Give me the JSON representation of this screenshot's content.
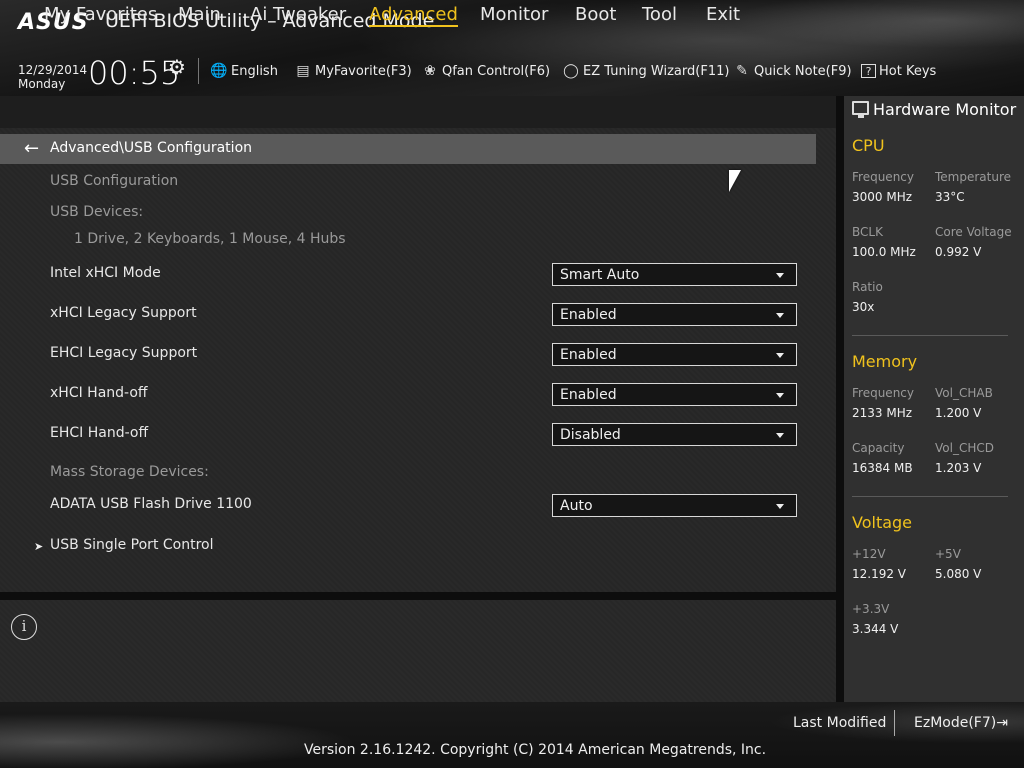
{
  "app": {
    "brand": "ASUS",
    "title": "UEFI BIOS Utility – Advanced Mode"
  },
  "status": {
    "date": "12/29/2014",
    "day": "Monday",
    "time": "00:55"
  },
  "toolbar": {
    "language": "English",
    "favorite": "MyFavorite(F3)",
    "qfan": "Qfan Control(F6)",
    "ez_tuning": "EZ Tuning Wizard(F11)",
    "quick_note": "Quick Note(F9)",
    "hot_keys": "Hot Keys"
  },
  "menu": {
    "items": [
      "My Favorites",
      "Main",
      "Ai Tweaker",
      "Advanced",
      "Monitor",
      "Boot",
      "Tool",
      "Exit"
    ],
    "active": "Advanced"
  },
  "breadcrumb": "Advanced\\USB Configuration",
  "content": {
    "section_title": "USB Configuration",
    "usb_devices_label": "USB Devices:",
    "usb_devices_value": "1 Drive, 2 Keyboards, 1 Mouse, 4 Hubs",
    "settings": [
      {
        "label": "Intel xHCI Mode",
        "value": "Smart Auto"
      },
      {
        "label": "xHCI Legacy Support",
        "value": "Enabled"
      },
      {
        "label": "EHCI Legacy Support",
        "value": "Enabled"
      },
      {
        "label": "xHCI Hand-off",
        "value": "Enabled"
      },
      {
        "label": "EHCI Hand-off",
        "value": "Disabled"
      }
    ],
    "mass_storage_label": "Mass Storage Devices:",
    "mass_storage_device": {
      "label": "ADATA USB Flash Drive 1100",
      "value": "Auto"
    },
    "submenu": "USB Single Port Control"
  },
  "hw_monitor": {
    "title": "Hardware Monitor",
    "cpu": {
      "heading": "CPU",
      "frequency_label": "Frequency",
      "frequency": "3000 MHz",
      "temperature_label": "Temperature",
      "temperature": "33°C",
      "bclk_label": "BCLK",
      "bclk": "100.0 MHz",
      "core_voltage_label": "Core Voltage",
      "core_voltage": "0.992 V",
      "ratio_label": "Ratio",
      "ratio": "30x"
    },
    "memory": {
      "heading": "Memory",
      "frequency_label": "Frequency",
      "frequency": "2133 MHz",
      "vol_chab_label": "Vol_CHAB",
      "vol_chab": "1.200 V",
      "capacity_label": "Capacity",
      "capacity": "16384 MB",
      "vol_chcd_label": "Vol_CHCD",
      "vol_chcd": "1.203 V"
    },
    "voltage": {
      "heading": "Voltage",
      "v12_label": "+12V",
      "v12": "12.192 V",
      "v5_label": "+5V",
      "v5": "5.080 V",
      "v33_label": "+3.3V",
      "v33": "3.344 V"
    }
  },
  "footer": {
    "last_modified": "Last Modified",
    "ezmode": "EzMode(F7)",
    "version": "Version 2.16.1242. Copyright (C) 2014 American Megatrends, Inc."
  },
  "colors": {
    "accent": "#f0c21d",
    "breadcrumb_bg": "#5a5a5a",
    "panel_bg": "#303030"
  }
}
